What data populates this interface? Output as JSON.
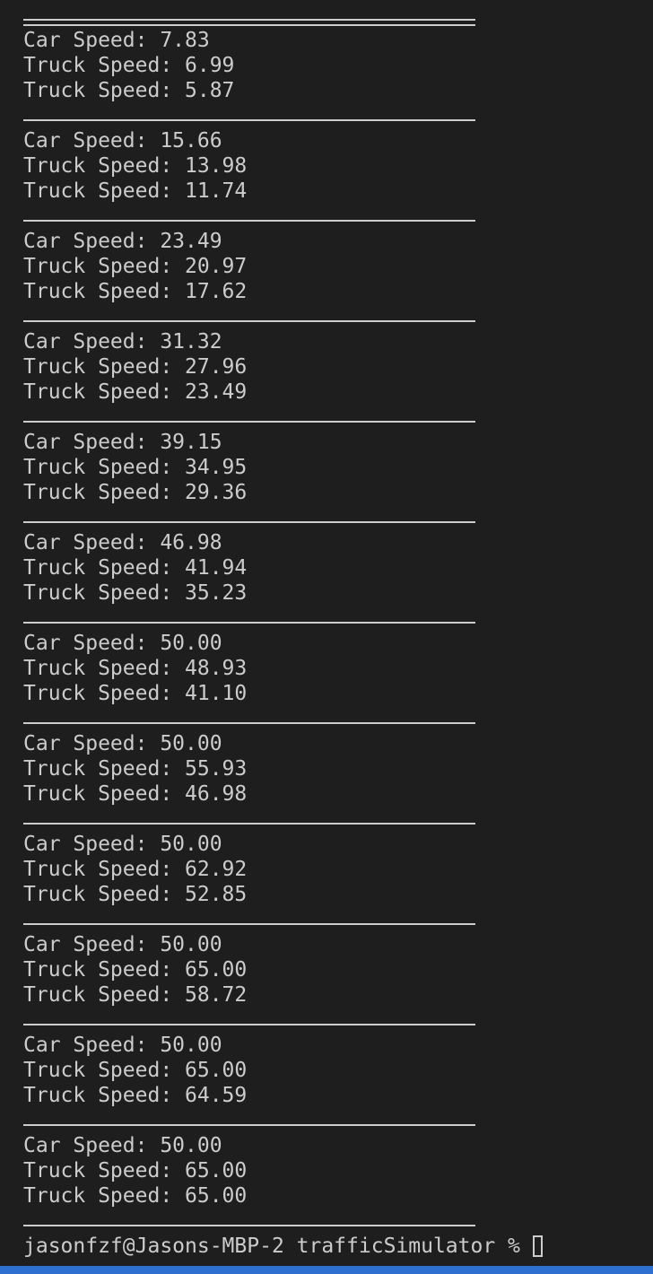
{
  "terminal": {
    "blocks": [
      {
        "car": "Car Speed: 7.83",
        "truck1": "Truck Speed: 6.99",
        "truck2": "Truck Speed: 5.87"
      },
      {
        "car": "Car Speed: 15.66",
        "truck1": "Truck Speed: 13.98",
        "truck2": "Truck Speed: 11.74"
      },
      {
        "car": "Car Speed: 23.49",
        "truck1": "Truck Speed: 20.97",
        "truck2": "Truck Speed: 17.62"
      },
      {
        "car": "Car Speed: 31.32",
        "truck1": "Truck Speed: 27.96",
        "truck2": "Truck Speed: 23.49"
      },
      {
        "car": "Car Speed: 39.15",
        "truck1": "Truck Speed: 34.95",
        "truck2": "Truck Speed: 29.36"
      },
      {
        "car": "Car Speed: 46.98",
        "truck1": "Truck Speed: 41.94",
        "truck2": "Truck Speed: 35.23"
      },
      {
        "car": "Car Speed: 50.00",
        "truck1": "Truck Speed: 48.93",
        "truck2": "Truck Speed: 41.10"
      },
      {
        "car": "Car Speed: 50.00",
        "truck1": "Truck Speed: 55.93",
        "truck2": "Truck Speed: 46.98"
      },
      {
        "car": "Car Speed: 50.00",
        "truck1": "Truck Speed: 62.92",
        "truck2": "Truck Speed: 52.85"
      },
      {
        "car": "Car Speed: 50.00",
        "truck1": "Truck Speed: 65.00",
        "truck2": "Truck Speed: 58.72"
      },
      {
        "car": "Car Speed: 50.00",
        "truck1": "Truck Speed: 65.00",
        "truck2": "Truck Speed: 64.59"
      },
      {
        "car": "Car Speed: 50.00",
        "truck1": "Truck Speed: 65.00",
        "truck2": "Truck Speed: 65.00"
      }
    ],
    "prompt": "jasonfzf@Jasons-MBP-2 trafficSimulator % "
  },
  "colors": {
    "background": "#1e1e1e",
    "text": "#cccccc",
    "status_bar": "#2f6fd0"
  }
}
